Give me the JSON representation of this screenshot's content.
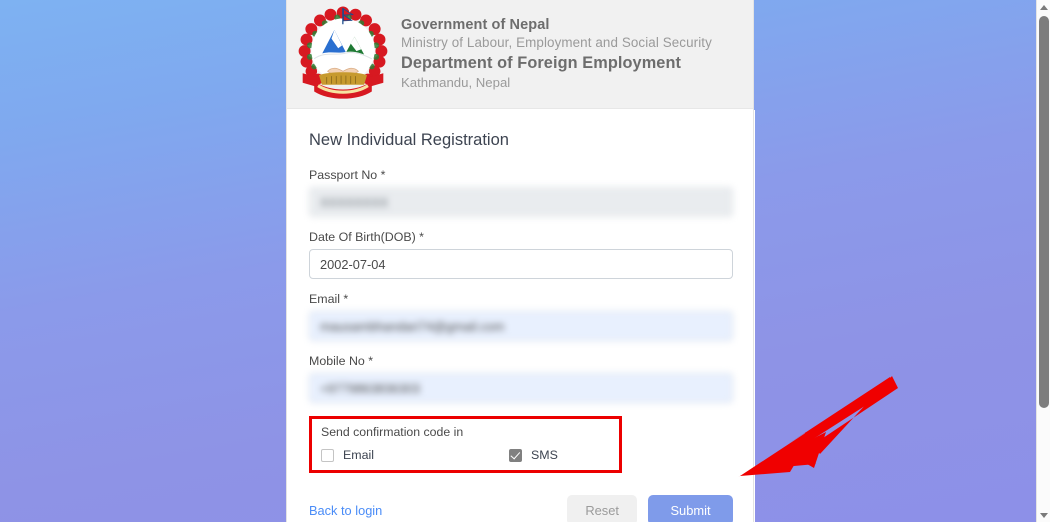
{
  "window": {
    "background_gradient_from": "#7eb2f2",
    "background_gradient_to": "#8d90e8"
  },
  "header": {
    "emblem_name": "nepal-emblem",
    "line1": "Government of Nepal",
    "line2": "Ministry of Labour, Employment and Social Security",
    "line3": "Department of Foreign Employment",
    "line4": "Kathmandu, Nepal"
  },
  "form": {
    "title": "New Individual Registration",
    "fields": [
      {
        "key": "passport",
        "label": "Passport No *",
        "value": "XXXXXXXX",
        "state": "disabled",
        "redacted": true
      },
      {
        "key": "dob",
        "label": "Date Of Birth(DOB) *",
        "value": "2002-07-04",
        "state": "normal",
        "redacted": false
      },
      {
        "key": "email",
        "label": "Email *",
        "value": "mausambhandari74@gmail.com",
        "state": "autofill",
        "redacted": true
      },
      {
        "key": "mobile",
        "label": "Mobile No *",
        "value": "+9779863836303",
        "state": "autofill",
        "redacted": true
      }
    ],
    "confirmation": {
      "title": "Send confirmation code in",
      "options": [
        {
          "label": "Email",
          "checked": false
        },
        {
          "label": "SMS",
          "checked": true
        }
      ],
      "highlight_color": "#ec0000"
    },
    "actions": {
      "back_link": "Back to login",
      "reset_label": "Reset",
      "submit_label": "Submit",
      "submit_color": "#7f9bea",
      "link_color": "#4a8cf7"
    }
  },
  "annotation": {
    "arrow_name": "red-arrow-pointing-to-submit",
    "color": "#f00000",
    "points_to": "Submit"
  },
  "scrollbar": {
    "orientation": "vertical",
    "thumb_color": "#7d7d7d"
  }
}
